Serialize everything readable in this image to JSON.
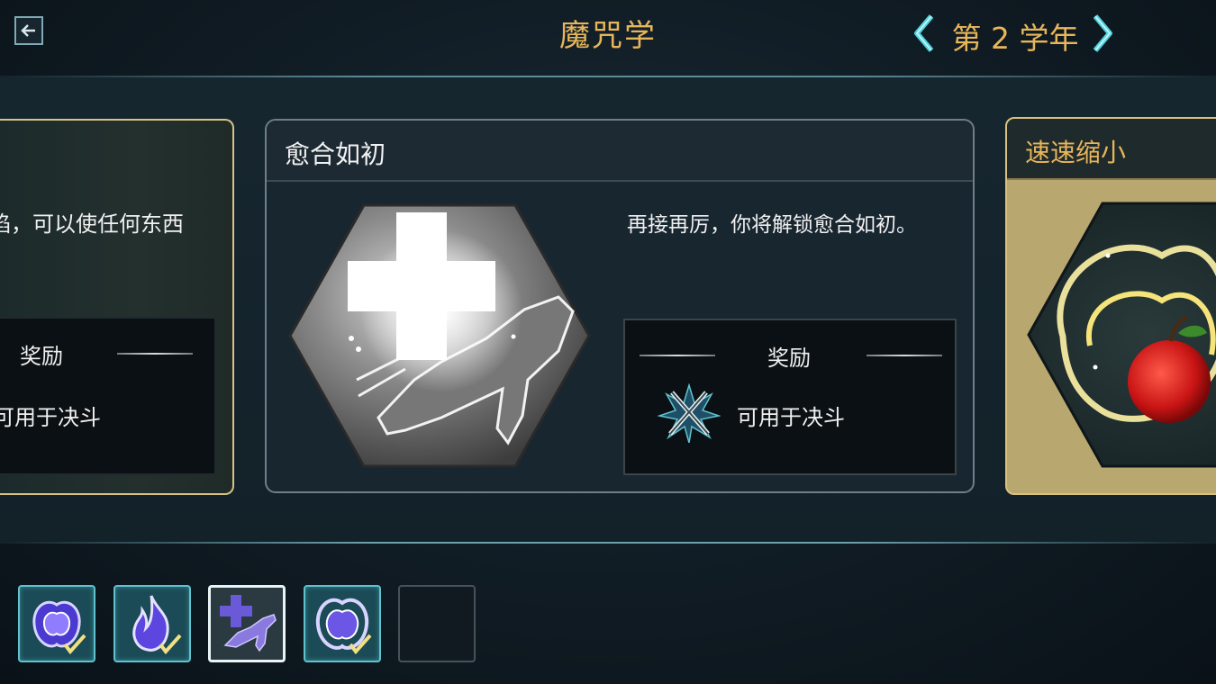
{
  "header": {
    "title": "魔咒学",
    "year_label": "第 2 学年"
  },
  "colors": {
    "gold": "#e8b65a",
    "teal": "#5fc3cf",
    "panel": "#182630"
  },
  "left_card": {
    "description": "焰，可以使任何东西",
    "reward_title": "奖励",
    "reward_text": "可用于决斗"
  },
  "center_card": {
    "title": "愈合如初",
    "description": "再接再厉，你将解锁愈合如初。",
    "reward_title": "奖励",
    "reward_text": "可用于决斗",
    "reward_icon": "crossed-wands-icon",
    "spell_icon": "healing-hand-icon"
  },
  "right_card": {
    "title": "速速缩小",
    "spell_icon": "shrinking-apple-icon"
  },
  "spell_slots": [
    {
      "icon": "apple-spell-icon",
      "state": "completed"
    },
    {
      "icon": "fire-spell-icon",
      "state": "completed"
    },
    {
      "icon": "healing-hand-icon",
      "state": "selected"
    },
    {
      "icon": "shrinking-apple-icon",
      "state": "completed"
    },
    {
      "icon": "locked-slot",
      "state": "empty"
    }
  ]
}
